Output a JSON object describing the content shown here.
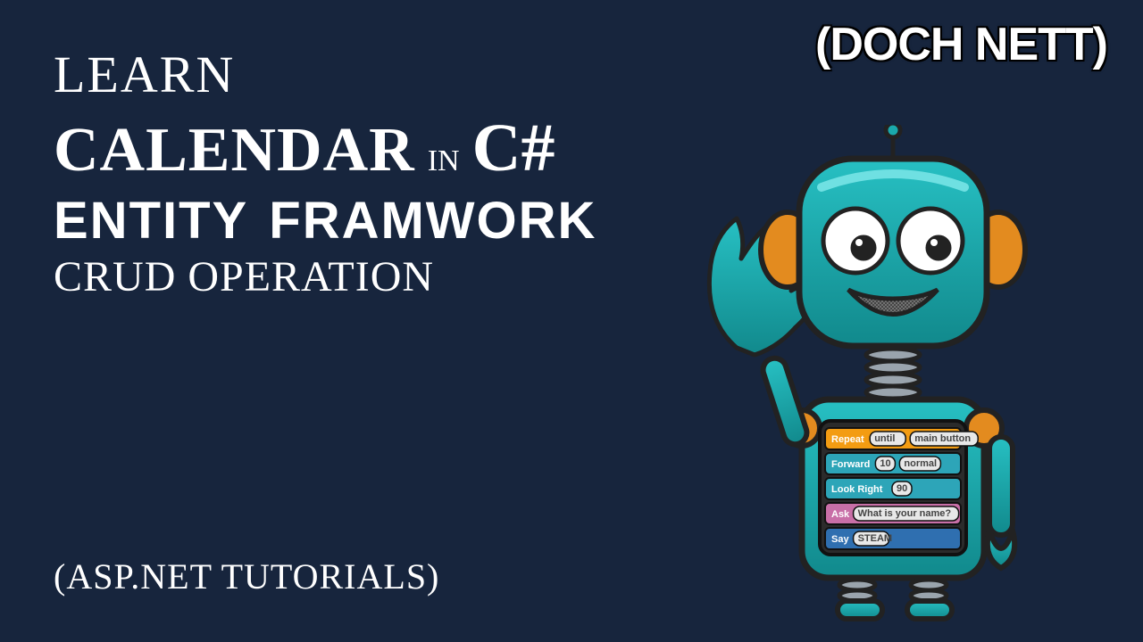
{
  "brand": "(DOCH NETT)",
  "title": {
    "learn": "LEARN",
    "calendar": "CALENDAR",
    "in": "IN",
    "csharp": "C#",
    "entity": "ENTITY FRAMWORK",
    "crud": "CRUD OPERATION"
  },
  "bottom": "(ASP.NET TUTORIALS)",
  "robot": {
    "code_rows": [
      {
        "bg": "#f39c12",
        "label": "Repeat",
        "pills": [
          "until",
          "main button"
        ]
      },
      {
        "bg": "#2da5b8",
        "label": "Forward",
        "pills": [
          "10",
          "normal"
        ]
      },
      {
        "bg": "#2da5b8",
        "label": "Look Right",
        "pills": [
          "90"
        ]
      },
      {
        "bg": "#c86fa7",
        "label": "Ask",
        "pills": [
          "What is your name?"
        ]
      },
      {
        "bg": "#2f6fb0",
        "label": "Say",
        "pills": [
          "STEAM"
        ]
      }
    ],
    "colors": {
      "body": "#1aa9ac",
      "body_dark": "#0e7b7e",
      "accent": "#e38b1f",
      "outline": "#222"
    }
  }
}
